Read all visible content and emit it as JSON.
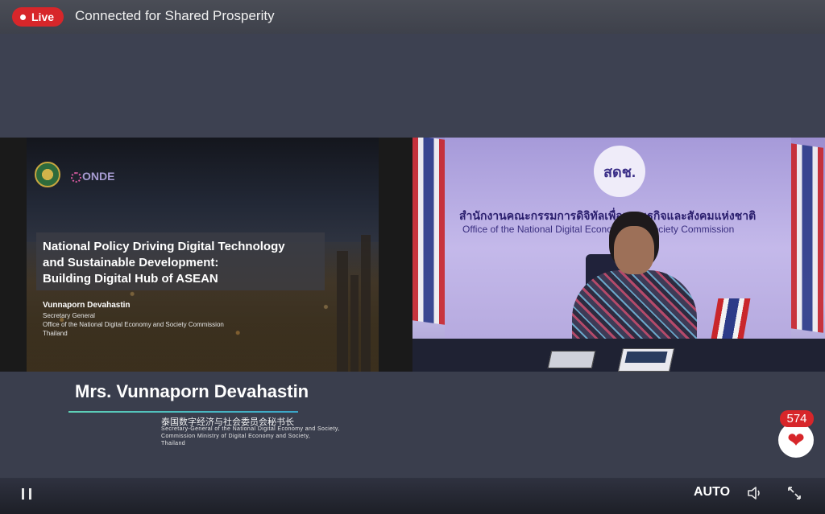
{
  "header": {
    "live_label": "Live",
    "title": "Connected for Shared Prosperity"
  },
  "slide": {
    "logo_text": "ONDE",
    "title_lines": [
      "National Policy Driving Digital Technology",
      "and Sustainable Development:",
      "Building Digital Hub of ASEAN"
    ],
    "speaker": "Vunnaporn Devahastin",
    "role_lines": [
      "Secretary General",
      "Office of the National Digital Economy and Society Commission",
      "Thailand"
    ]
  },
  "video": {
    "logo_text": "สดช.",
    "org_thai": "สำนักงานคณะกรรมการดิจิทัลเพื่อเศรษฐกิจและสังคมแห่งชาติ",
    "org_english": "Office of the National Digital Economy and Society Commission"
  },
  "caption": {
    "name": "Mrs. Vunnaporn Devahastin",
    "title_zh": "泰国数字经济与社会委员会秘书长",
    "title_en_lines": [
      "Secretary-General of the National Digital Economy and Society,",
      "Commission Ministry of Digital Economy and Society,",
      "Thailand"
    ]
  },
  "likes": {
    "count": "574",
    "icon": "heart-icon"
  },
  "controls": {
    "quality_label": "AUTO",
    "pause_icon": "pause-icon",
    "volume_icon": "volume-icon",
    "fullscreen_icon": "fullscreen-icon"
  },
  "colors": {
    "live_red": "#d7262a",
    "background": "#3a3e4d",
    "underline_accent": "#5fd1b6"
  }
}
